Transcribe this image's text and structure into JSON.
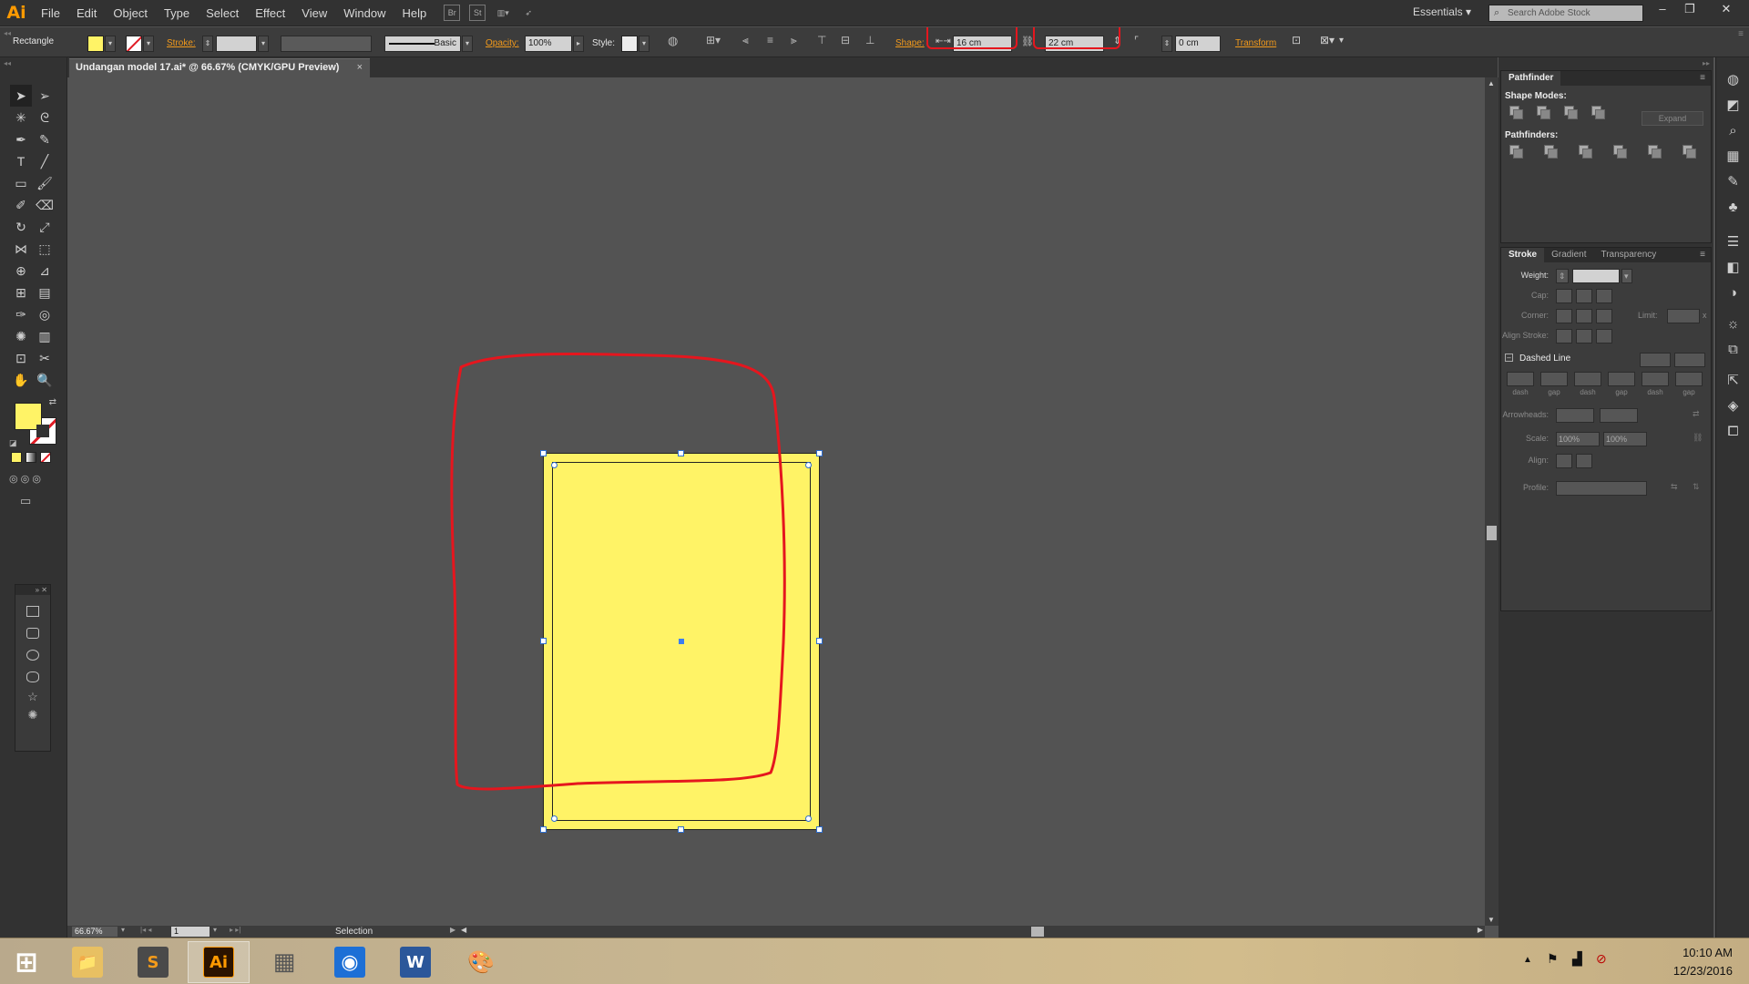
{
  "app": {
    "logo": "Ai",
    "menu": [
      "File",
      "Edit",
      "Object",
      "Type",
      "Select",
      "Effect",
      "View",
      "Window",
      "Help"
    ],
    "menu_icons": [
      "Br",
      "St",
      "workspace-arrange-icon",
      "gpu-performance-icon"
    ],
    "workspace": "Essentials",
    "search_placeholder": "Search Adobe Stock",
    "window_buttons": [
      "minimize",
      "restore",
      "close"
    ]
  },
  "controlbar": {
    "selection_type": "Rectangle",
    "fill_color": "#fff366",
    "stroke_label": "Stroke:",
    "stroke_style": "Basic",
    "opacity_label": "Opacity:",
    "opacity_value": "100%",
    "style_label": "Style:",
    "shape_label": "Shape:",
    "width_value": "16 cm",
    "height_value": "22 cm",
    "corner_value": "0 cm",
    "transform_label": "Transform"
  },
  "document": {
    "tab_title": "Undangan model 17.ai* @ 66.67% (CMYK/GPU Preview)",
    "close_glyph": "×"
  },
  "canvas": {
    "artboard_fill": "#fff366",
    "annotation_color": "#e5161e"
  },
  "statusbar": {
    "zoom": "66.67%",
    "page": "1",
    "status": "Selection"
  },
  "pathfinder": {
    "title": "Pathfinder",
    "shape_modes_label": "Shape Modes:",
    "expand_label": "Expand",
    "pathfinders_label": "Pathfinders:"
  },
  "stroke_panel": {
    "tabs": [
      "Stroke",
      "Gradient",
      "Transparency"
    ],
    "weight_label": "Weight:",
    "cap_label": "Cap:",
    "corner_label": "Corner:",
    "limit_label": "Limit:",
    "limit_suffix": "x",
    "align_label": "Align Stroke:",
    "dashed_label": "Dashed Line",
    "dash_labels": [
      "dash",
      "gap",
      "dash",
      "gap",
      "dash",
      "gap"
    ],
    "arrowheads_label": "Arrowheads:",
    "scale_label": "Scale:",
    "scale_start": "100%",
    "scale_end": "100%",
    "align2_label": "Align:",
    "profile_label": "Profile:"
  },
  "taskbar": {
    "apps": [
      {
        "name": "start-button",
        "glyph": "⊞"
      },
      {
        "name": "file-explorer",
        "glyph": "📁"
      },
      {
        "name": "sublime-text",
        "glyph": "S"
      },
      {
        "name": "adobe-illustrator",
        "glyph": "Ai"
      },
      {
        "name": "task-view",
        "glyph": "▦"
      },
      {
        "name": "circle-app",
        "glyph": "◉"
      },
      {
        "name": "word",
        "glyph": "W"
      },
      {
        "name": "paint",
        "glyph": "🎨"
      }
    ],
    "time": "10:10 AM",
    "date": "12/23/2016"
  }
}
